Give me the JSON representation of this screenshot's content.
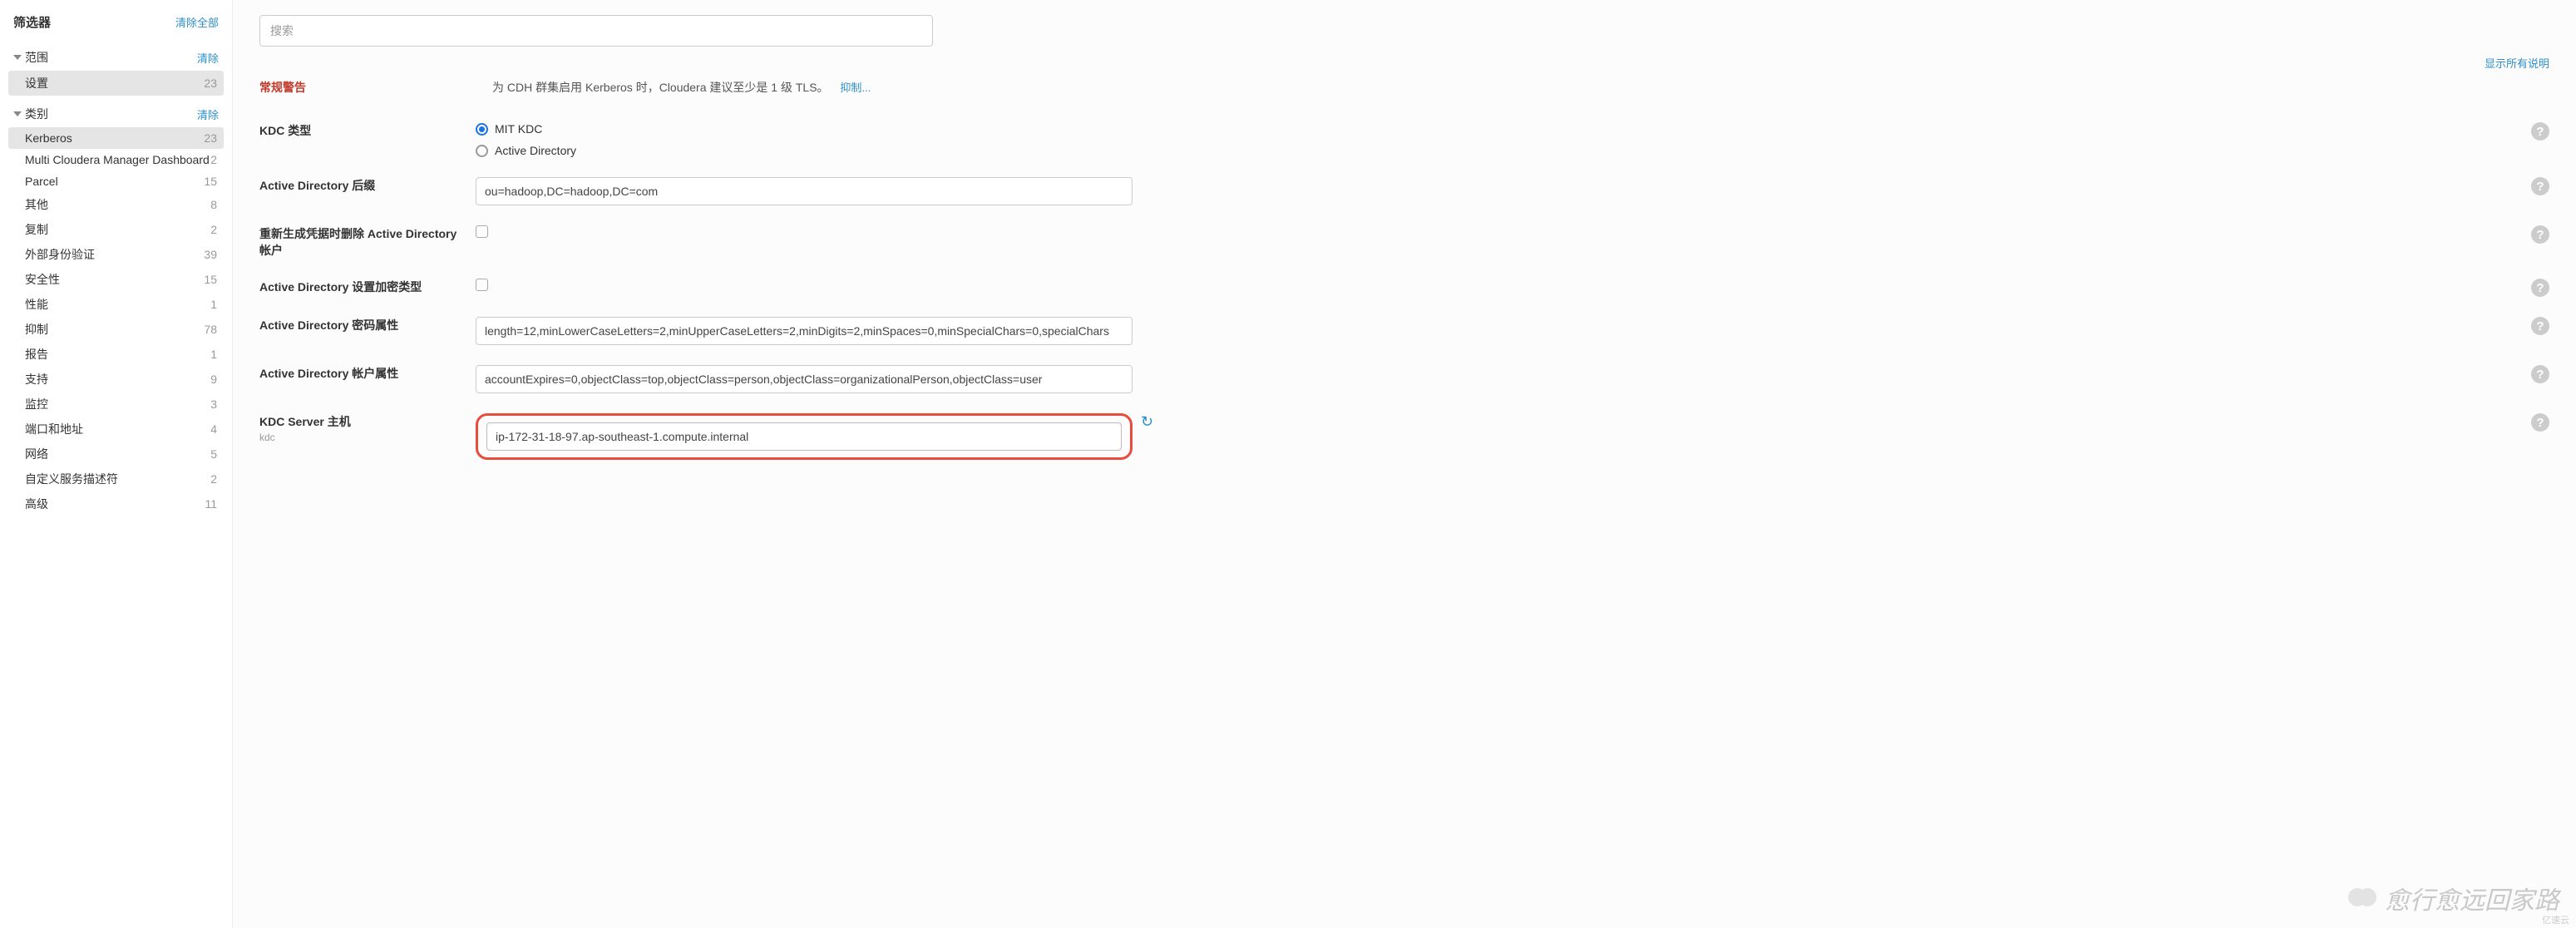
{
  "sidebar": {
    "title": "筛选器",
    "clear_all": "清除全部",
    "scope": {
      "title": "范围",
      "clear": "清除",
      "items": [
        {
          "label": "设置",
          "count": "23",
          "selected": true
        }
      ]
    },
    "category": {
      "title": "类别",
      "clear": "清除",
      "items": [
        {
          "label": "Kerberos",
          "count": "23",
          "selected": true
        },
        {
          "label": "Multi Cloudera Manager Dashboard",
          "count": "2"
        },
        {
          "label": "Parcel",
          "count": "15"
        },
        {
          "label": "其他",
          "count": "8"
        },
        {
          "label": "复制",
          "count": "2"
        },
        {
          "label": "外部身份验证",
          "count": "39"
        },
        {
          "label": "安全性",
          "count": "15"
        },
        {
          "label": "性能",
          "count": "1"
        },
        {
          "label": "抑制",
          "count": "78"
        },
        {
          "label": "报告",
          "count": "1"
        },
        {
          "label": "支持",
          "count": "9"
        },
        {
          "label": "监控",
          "count": "3"
        },
        {
          "label": "端口和地址",
          "count": "4"
        },
        {
          "label": "网络",
          "count": "5"
        },
        {
          "label": "自定义服务描述符",
          "count": "2"
        },
        {
          "label": "高级",
          "count": "11"
        }
      ]
    }
  },
  "main": {
    "search_placeholder": "搜索",
    "show_all_desc": "显示所有说明",
    "warning": {
      "label": "常规警告",
      "text": "为 CDH 群集启用 Kerberos 时，Cloudera 建议至少是 1 级 TLS。",
      "suppress": "抑制..."
    },
    "settings": {
      "kdc_type": {
        "label": "KDC 类型",
        "options": [
          "MIT KDC",
          "Active Directory"
        ],
        "selected": 0
      },
      "ad_suffix": {
        "label": "Active Directory 后缀",
        "value": "ou=hadoop,DC=hadoop,DC=com"
      },
      "ad_regen_delete": {
        "label": "重新生成凭据时删除 Active Directory 帐户"
      },
      "ad_enc_type": {
        "label": "Active Directory 设置加密类型"
      },
      "ad_pw_attr": {
        "label": "Active Directory 密码属性",
        "value": "length=12,minLowerCaseLetters=2,minUpperCaseLetters=2,minDigits=2,minSpaces=0,minSpecialChars=0,specialChars"
      },
      "ad_acct_attr": {
        "label": "Active Directory 帐户属性",
        "value": "accountExpires=0,objectClass=top,objectClass=person,objectClass=organizationalPerson,objectClass=user"
      },
      "kdc_host": {
        "label": "KDC Server 主机",
        "sub": "kdc",
        "value": "ip-172-31-18-97.ap-southeast-1.compute.internal"
      }
    }
  },
  "watermark": "愈行愈远回家路",
  "footer": "亿速云"
}
